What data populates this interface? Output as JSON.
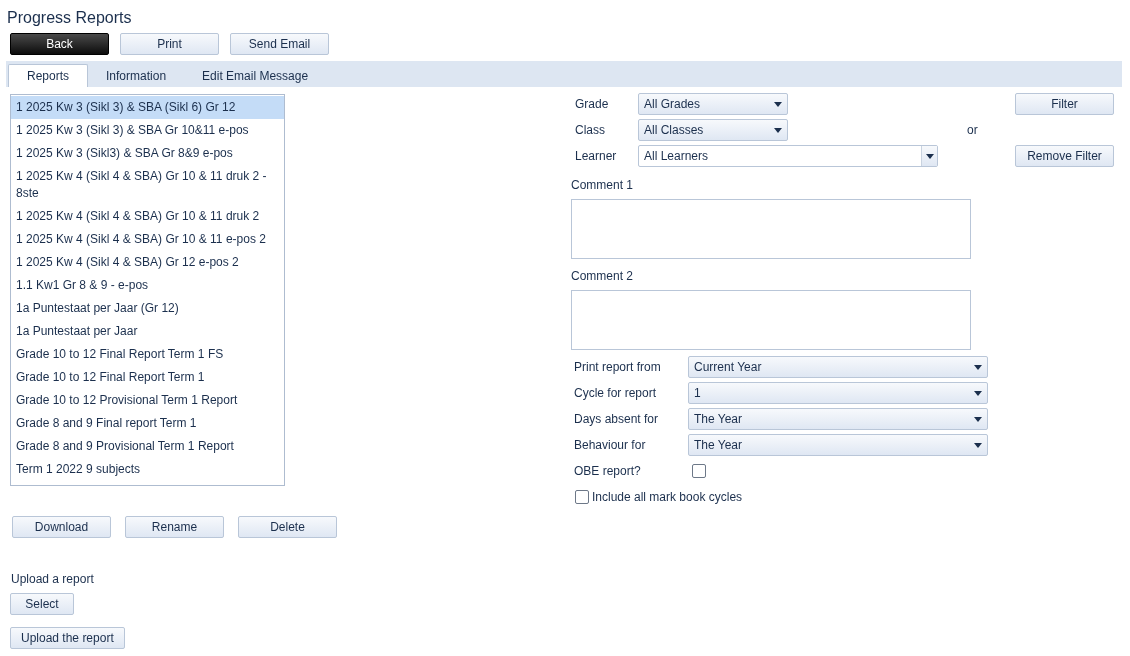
{
  "title": "Progress Reports",
  "toolbar": [
    {
      "label": "Back",
      "kind": "dark"
    },
    {
      "label": "Print",
      "kind": "normal"
    },
    {
      "label": "Send Email",
      "kind": "normal"
    }
  ],
  "tabs": [
    {
      "label": "Reports",
      "selected": true
    },
    {
      "label": "Information",
      "selected": false
    },
    {
      "label": "Edit Email Message",
      "selected": false
    }
  ],
  "reports": [
    {
      "label": "1 2025 Kw 3 (Sikl 3) & SBA (Sikl 6) Gr 12",
      "selected": true
    },
    {
      "label": "1 2025 Kw 3 (Sikl 3) & SBA Gr 10&11 e-pos",
      "selected": false
    },
    {
      "label": "1 2025 Kw 3 (Sikl3) & SBA Gr 8&9 e-pos",
      "selected": false
    },
    {
      "label": "1 2025 Kw 4 (Sikl 4 & SBA) Gr 10 & 11 druk 2 - 8ste",
      "selected": false
    },
    {
      "label": "1 2025 Kw 4 (Sikl 4 & SBA) Gr 10 & 11 druk 2",
      "selected": false
    },
    {
      "label": "1 2025 Kw 4 (Sikl 4 & SBA) Gr 10 & 11 e-pos 2",
      "selected": false
    },
    {
      "label": "1 2025 Kw 4 (Sikl 4 & SBA) Gr 12 e-pos 2",
      "selected": false
    },
    {
      "label": "1.1 Kw1 Gr 8 & 9 - e-pos",
      "selected": false
    },
    {
      "label": "1a Puntestaat per Jaar (Gr 12)",
      "selected": false
    },
    {
      "label": "1a Puntestaat per Jaar",
      "selected": false
    },
    {
      "label": "Grade 10 to 12 Final Report Term 1 FS",
      "selected": false
    },
    {
      "label": "Grade 10 to 12 Final Report Term 1",
      "selected": false
    },
    {
      "label": "Grade 10 to 12 Provisional Term 1 Report",
      "selected": false
    },
    {
      "label": "Grade 8 and 9 Final report Term 1",
      "selected": false
    },
    {
      "label": "Grade 8 and 9 Provisional Term 1 Report",
      "selected": false
    },
    {
      "label": "Term 1 2022 9 subjects",
      "selected": false
    }
  ],
  "list_actions": [
    "Download",
    "Rename",
    "Delete"
  ],
  "upload": {
    "heading": "Upload a report",
    "buttons": [
      "Select",
      "Upload the report"
    ]
  },
  "filters": [
    {
      "label": "Grade",
      "value": "All Grades",
      "kind": "dropdown"
    },
    {
      "label": "Class",
      "value": "All Classes",
      "kind": "dropdown"
    },
    {
      "label": "Learner",
      "value": "All Learners",
      "kind": "combo"
    }
  ],
  "filter_buttons": [
    "Filter",
    "Remove Filter"
  ],
  "or_label": "or",
  "comments": [
    {
      "label": "Comment 1"
    },
    {
      "label": "Comment 2"
    }
  ],
  "options": [
    {
      "label": "Print report from",
      "value": "Current Year"
    },
    {
      "label": "Cycle for report",
      "value": "1"
    },
    {
      "label": "Days absent for",
      "value": "The Year"
    },
    {
      "label": "Behaviour for",
      "value": "The Year"
    }
  ],
  "obe": {
    "label": "OBE report?",
    "checked": false
  },
  "include_all": {
    "label": "Include all mark book cycles",
    "checked": false
  }
}
